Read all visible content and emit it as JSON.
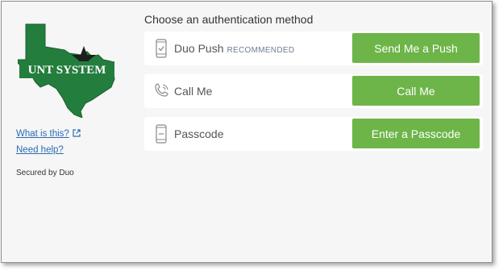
{
  "logo": {
    "text": "UNT SYSTEM"
  },
  "links": {
    "what_is_this": "What is this?",
    "need_help": "Need help?"
  },
  "secured_by": "Secured by Duo",
  "heading": "Choose an authentication method",
  "methods": [
    {
      "label": "Duo Push",
      "badge": "RECOMMENDED",
      "button": "Send Me a Push",
      "icon": "phone-push-icon"
    },
    {
      "label": "Call Me",
      "button": "Call Me",
      "icon": "phone-call-icon"
    },
    {
      "label": "Passcode",
      "button": "Enter a Passcode",
      "icon": "passcode-phone-icon"
    }
  ],
  "colors": {
    "button_green": "#6db548",
    "logo_green": "#237d3c",
    "link_blue": "#2b6bb6"
  }
}
